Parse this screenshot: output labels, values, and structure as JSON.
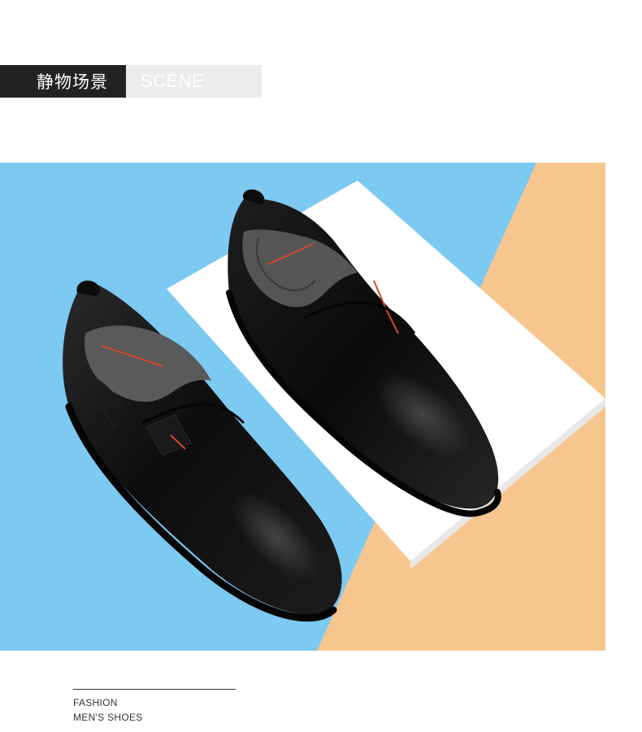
{
  "header": {
    "title_cn": "静物场景",
    "title_en": "SCENE"
  },
  "scene": {
    "image_description_name": "product-photo-black-leather-slip-on-shoes",
    "colors": {
      "background_blue": "#7cc9f2",
      "background_orange": "#f7c68f",
      "white_card": "#ffffff",
      "leather": "#111111",
      "insole": "#5a5a5a",
      "accent_red": "#d9462a"
    }
  },
  "footer": {
    "line1": "FASHION",
    "line2": "MEN'S SHOES"
  }
}
